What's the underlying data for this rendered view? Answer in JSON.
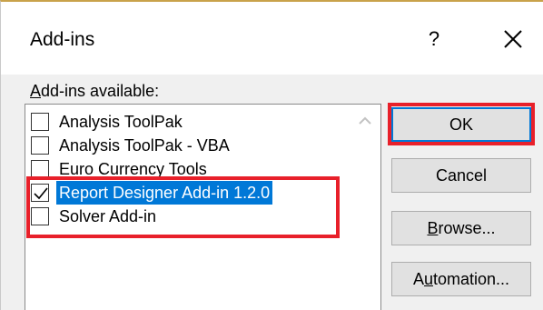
{
  "dialog": {
    "title": "Add-ins",
    "help_label": "?",
    "section_label_underlined": "A",
    "section_label_rest": "dd-ins available:"
  },
  "addins": [
    {
      "label": "Analysis ToolPak",
      "checked": false,
      "selected": false
    },
    {
      "label": "Analysis ToolPak - VBA",
      "checked": false,
      "selected": false
    },
    {
      "label": "Euro Currency Tools",
      "checked": false,
      "selected": false
    },
    {
      "label": "Report Designer Add-in 1.2.0",
      "checked": true,
      "selected": true
    },
    {
      "label": "Solver Add-in",
      "checked": false,
      "selected": false
    }
  ],
  "buttons": {
    "ok": "OK",
    "cancel": "Cancel",
    "browse_underlined": "B",
    "browse_rest": "rowse...",
    "automation_prefix": "A",
    "automation_underlined": "u",
    "automation_rest": "tomation..."
  },
  "colors": {
    "highlight": "#e8202a",
    "selection": "#0078d7",
    "dialog_bg": "#f0f0f0"
  },
  "icons": {
    "close": "close-icon",
    "scroll_up": "chevron-up-icon",
    "check": "checkmark-icon"
  }
}
